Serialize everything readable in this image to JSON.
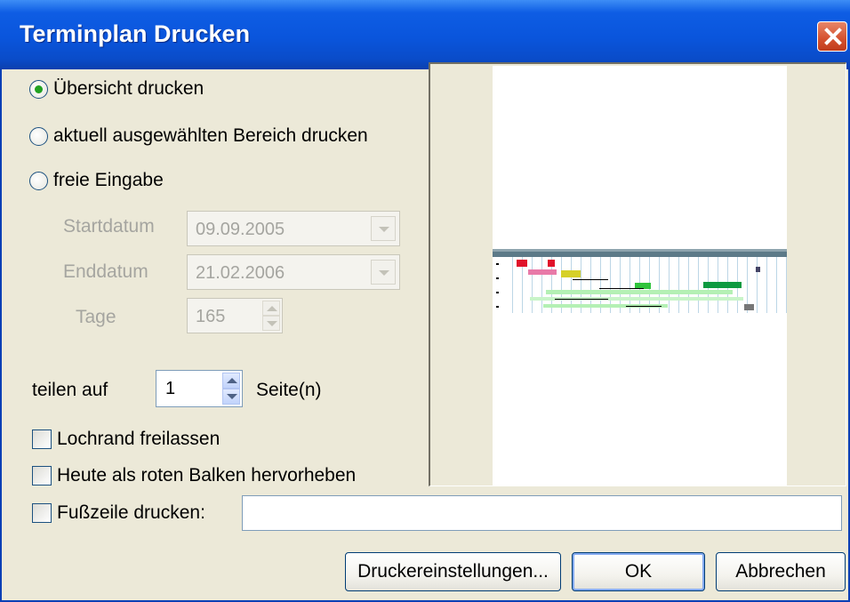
{
  "window": {
    "title": "Terminplan Drucken"
  },
  "options": {
    "overview": "Übersicht drucken",
    "selected_range": "aktuell ausgewählten Bereich drucken",
    "free_input": "freie Eingabe",
    "selected": "overview"
  },
  "fields": {
    "start_label": "Startdatum",
    "start_value": "09.09.2005",
    "end_label": "Enddatum",
    "end_value": "21.02.2006",
    "days_label": "Tage",
    "days_value": "165"
  },
  "split": {
    "label": "teilen auf",
    "value": "1",
    "unit": "Seite(n)"
  },
  "checkboxes": {
    "punch_margin": "Lochrand freilassen",
    "today_red": "Heute als roten Balken hervorheben",
    "footer": "Fußzeile drucken:"
  },
  "footer_input": {
    "value": ""
  },
  "buttons": {
    "printer_settings": "Druckereinstellungen...",
    "ok": "OK",
    "cancel": "Abbrechen"
  },
  "colors": {
    "title_bar": "#0a55dc",
    "close_button": "#d4502e",
    "dialog_bg": "#ece9d8",
    "radio_dot": "#21a121"
  }
}
